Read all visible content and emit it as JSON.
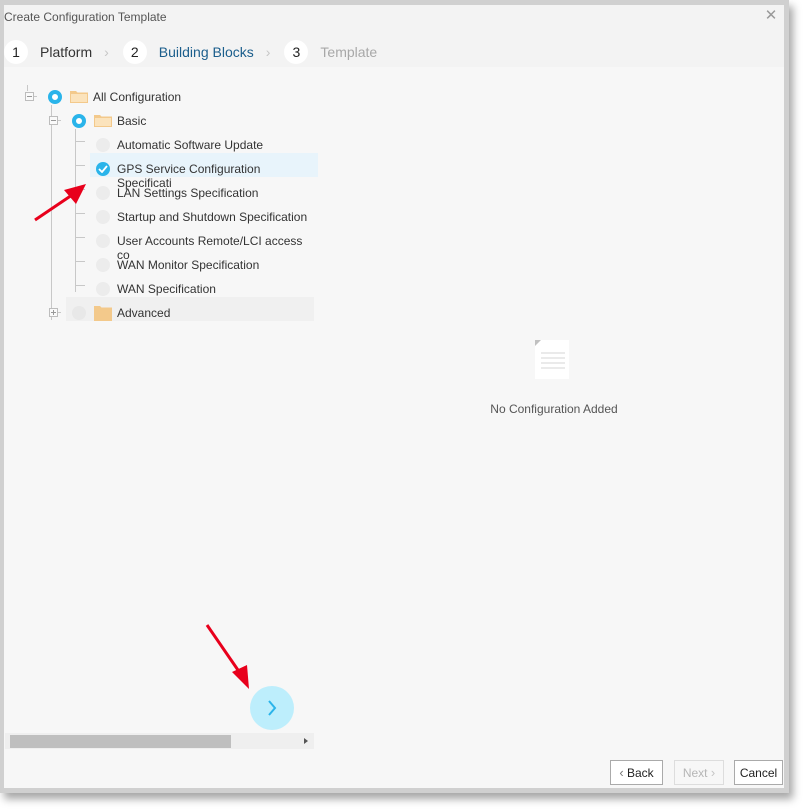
{
  "dialog": {
    "title": "Create Configuration Template",
    "close_icon": "close-icon"
  },
  "steps": [
    {
      "number": "1",
      "label": "Platform",
      "state": "completed"
    },
    {
      "number": "2",
      "label": "Building Blocks",
      "state": "active"
    },
    {
      "number": "3",
      "label": "Template",
      "state": "disabled"
    }
  ],
  "step_separator": "›",
  "tree": {
    "root": {
      "label": "All Configuration",
      "state": "partial",
      "expanded": true
    },
    "basic": {
      "label": "Basic",
      "state": "partial",
      "expanded": true
    },
    "items": [
      {
        "label": "Automatic Software Update Specificat",
        "checked": false
      },
      {
        "label": "GPS Service Configuration Specificati",
        "checked": true
      },
      {
        "label": "LAN Settings Specification",
        "checked": false
      },
      {
        "label": "Startup and Shutdown Specification",
        "checked": false
      },
      {
        "label": "User Accounts Remote/LCI access co",
        "checked": false
      },
      {
        "label": "WAN Monitor Specification",
        "checked": false
      },
      {
        "label": "WAN Specification",
        "checked": false
      }
    ],
    "advanced": {
      "label": "Advanced",
      "state": "disabled",
      "expanded": false
    }
  },
  "empty_state": {
    "icon": "document-icon",
    "text": "No Configuration Added"
  },
  "add_button": {
    "icon": "chevron-right-icon"
  },
  "footer": {
    "back_label": "Back",
    "next_label": "Next",
    "cancel_label": "Cancel",
    "back_chevron": "‹",
    "next_chevron": "›"
  },
  "colors": {
    "accent": "#2ab4ea",
    "active_step": "#1b5e8c",
    "fab_bg": "#bdeefc",
    "folder": "#f3c98b",
    "annotation_arrow": "#e8001c"
  }
}
